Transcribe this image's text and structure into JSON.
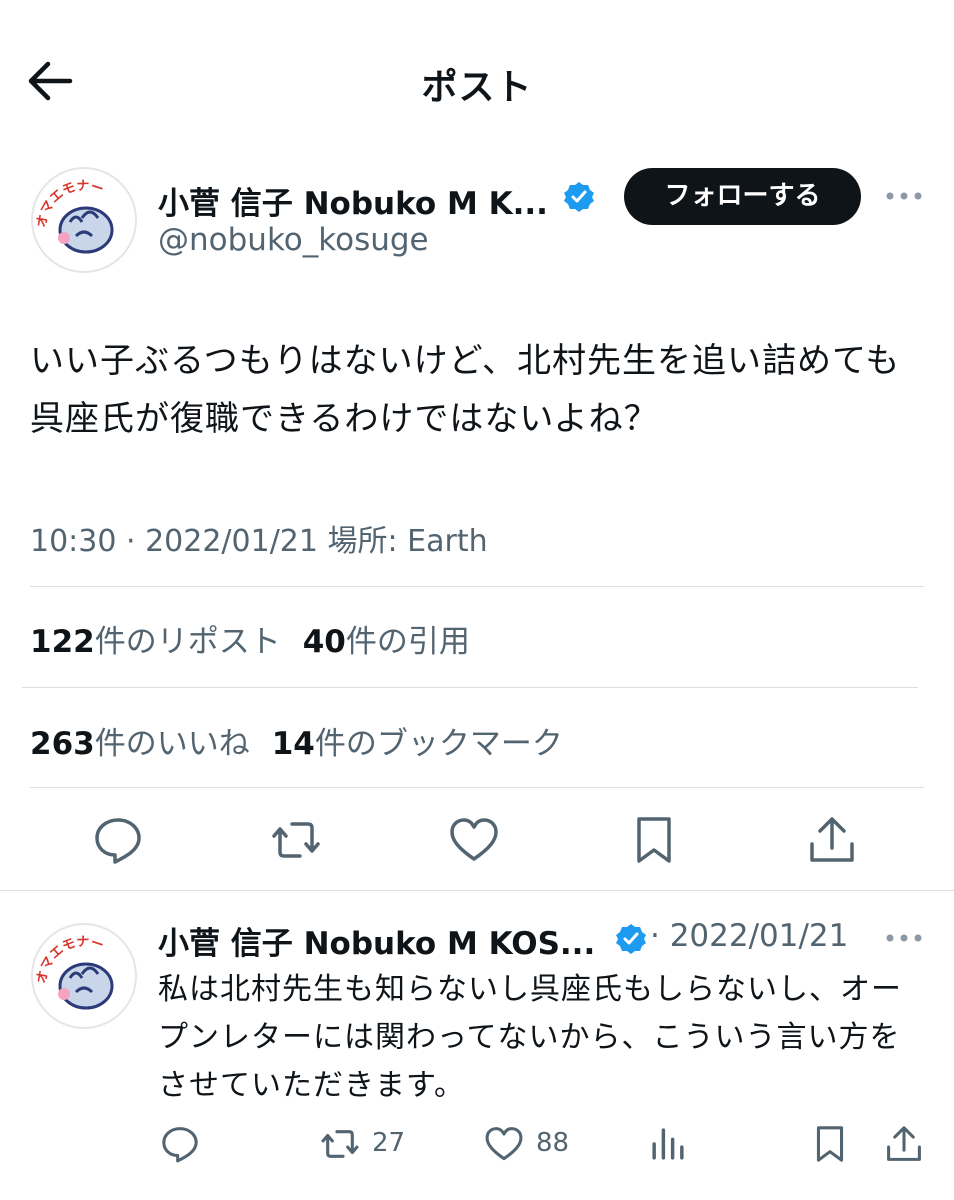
{
  "header": {
    "title": "ポスト"
  },
  "tweet": {
    "display_name": "小菅 信子 Nobuko M K...",
    "handle": "@nobuko_kosuge",
    "follow_label": "フォローする",
    "text": "いい子ぶるつもりはないけど、北村先生を追い詰めても呉座氏が復職できるわけではないよね？",
    "timestamp": "10:30 · 2022/01/21 場所: Earth",
    "stats": {
      "reposts_count": "122",
      "reposts_label": "件のリポスト",
      "quotes_count": "40",
      "quotes_label": "件の引用",
      "likes_count": "263",
      "likes_label": "件のいいね",
      "bookmarks_count": "14",
      "bookmarks_label": "件のブックマーク"
    }
  },
  "reply": {
    "display_name": "小菅 信子 Nobuko M KOS...",
    "date": "· 2022/01/21",
    "text": "私は北村先生も知らないし呉座氏もしらないし、オープンレターには関わってないから、こういう言い方をさせていただきます。",
    "retweet_count": "27",
    "like_count": "88"
  },
  "avatar_text": "オマエモナー",
  "colors": {
    "accent": "#1d9bf0",
    "text": "#0f1419",
    "secondary": "#536471"
  }
}
